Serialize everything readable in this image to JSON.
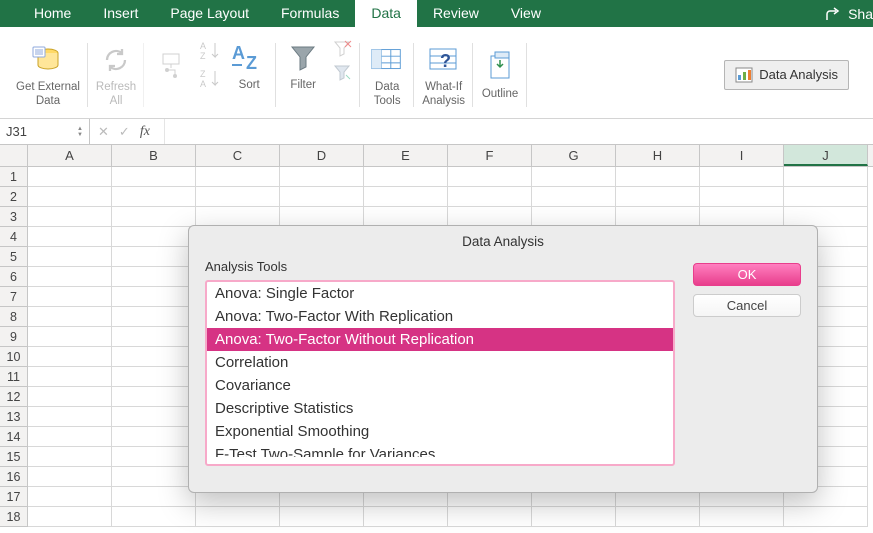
{
  "tabs": {
    "items": [
      "Home",
      "Insert",
      "Page Layout",
      "Formulas",
      "Data",
      "Review",
      "View"
    ],
    "active_index": 4,
    "share_label": "Sha"
  },
  "ribbon": {
    "get_external_data": "Get External\nData",
    "refresh_all": "Refresh\nAll",
    "sort": "Sort",
    "filter": "Filter",
    "data_tools": "Data\nTools",
    "what_if": "What-If\nAnalysis",
    "outline": "Outline",
    "data_analysis_btn": "Data Analysis"
  },
  "formula_bar": {
    "name_box": "J31",
    "fx": "fx",
    "value": ""
  },
  "grid": {
    "columns": [
      "A",
      "B",
      "C",
      "D",
      "E",
      "F",
      "G",
      "H",
      "I",
      "J"
    ],
    "selected_column_index": 9,
    "rows": [
      1,
      2,
      3,
      4,
      5,
      6,
      7,
      8,
      9,
      10,
      11,
      12,
      13,
      14,
      15,
      16,
      17,
      18
    ]
  },
  "dialog": {
    "title": "Data Analysis",
    "tools_label": "Analysis Tools",
    "tools": [
      "Anova: Single Factor",
      "Anova: Two-Factor With Replication",
      "Anova: Two-Factor Without Replication",
      "Correlation",
      "Covariance",
      "Descriptive Statistics",
      "Exponential Smoothing",
      "F-Test Two-Sample for Variances"
    ],
    "selected_index": 2,
    "ok_label": "OK",
    "cancel_label": "Cancel"
  }
}
